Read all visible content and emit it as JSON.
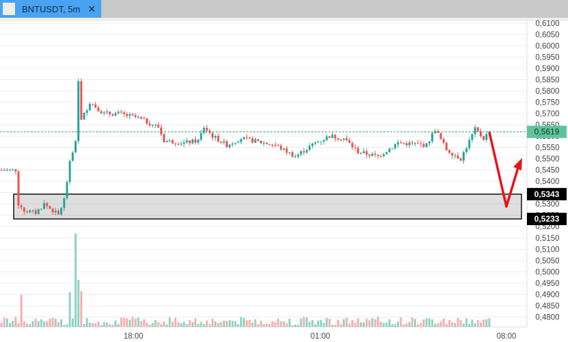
{
  "tab": {
    "title": "BNTUSDT, 5m",
    "close": "✕"
  },
  "chart_data": {
    "type": "candlestick",
    "symbol": "BNTUSDT",
    "interval": "5m",
    "price_ticks": [
      "0,6100",
      "0,6050",
      "0,6000",
      "0,5950",
      "0,5900",
      "0,5850",
      "0,5800",
      "0,5750",
      "0,5700",
      "0,5650",
      "0,5600",
      "0,5550",
      "0,5500",
      "0,5450",
      "0,5400",
      "0,5350",
      "0,5300",
      "0,5250",
      "0,5200"
    ],
    "volume_ticks": [
      "0,5150",
      "0,5100",
      "0,5050",
      "0,5000",
      "0,4950",
      "0,4900",
      "0,4850",
      "0,4800"
    ],
    "time_ticks": [
      "18:00",
      "01:00",
      "08:00"
    ],
    "last_price": "0,5619",
    "last_price_value": 0.5619,
    "zone": {
      "top_label": "0,5343",
      "bottom_label": "0,5233",
      "top": 0.5343,
      "bottom": 0.5233
    },
    "close_keypoints": [
      [
        0,
        0.545
      ],
      [
        5,
        0.545
      ],
      [
        6,
        0.53
      ],
      [
        8,
        0.527
      ],
      [
        12,
        0.526
      ],
      [
        15,
        0.53
      ],
      [
        20,
        0.525
      ],
      [
        22,
        0.532
      ],
      [
        24,
        0.548
      ],
      [
        26,
        0.557
      ],
      [
        27,
        0.585
      ],
      [
        28,
        0.567
      ],
      [
        31,
        0.575
      ],
      [
        36,
        0.57
      ],
      [
        41,
        0.57
      ],
      [
        48,
        0.568
      ],
      [
        55,
        0.564
      ],
      [
        57,
        0.558
      ],
      [
        64,
        0.557
      ],
      [
        69,
        0.558
      ],
      [
        71,
        0.564
      ],
      [
        74,
        0.56
      ],
      [
        79,
        0.556
      ],
      [
        84,
        0.559
      ],
      [
        88,
        0.558
      ],
      [
        96,
        0.556
      ],
      [
        103,
        0.551
      ],
      [
        110,
        0.557
      ],
      [
        115,
        0.56
      ],
      [
        120,
        0.559
      ],
      [
        125,
        0.553
      ],
      [
        132,
        0.551
      ],
      [
        139,
        0.557
      ],
      [
        149,
        0.556
      ],
      [
        152,
        0.563
      ],
      [
        156,
        0.554
      ],
      [
        161,
        0.55
      ],
      [
        166,
        0.563
      ],
      [
        169,
        0.559
      ],
      [
        171,
        0.562
      ]
    ],
    "volume_spikes": {
      "26": 0.517,
      "27": 0.4965,
      "28": 0.4915,
      "7": 0.49,
      "24": 0.491
    }
  },
  "colors": {
    "up": "#26a69a",
    "down": "#ef5350",
    "upvol": "#8fd3c3",
    "downvol": "#f4b0ae",
    "arrow": "#e8131a",
    "last": "#5fc49a"
  }
}
